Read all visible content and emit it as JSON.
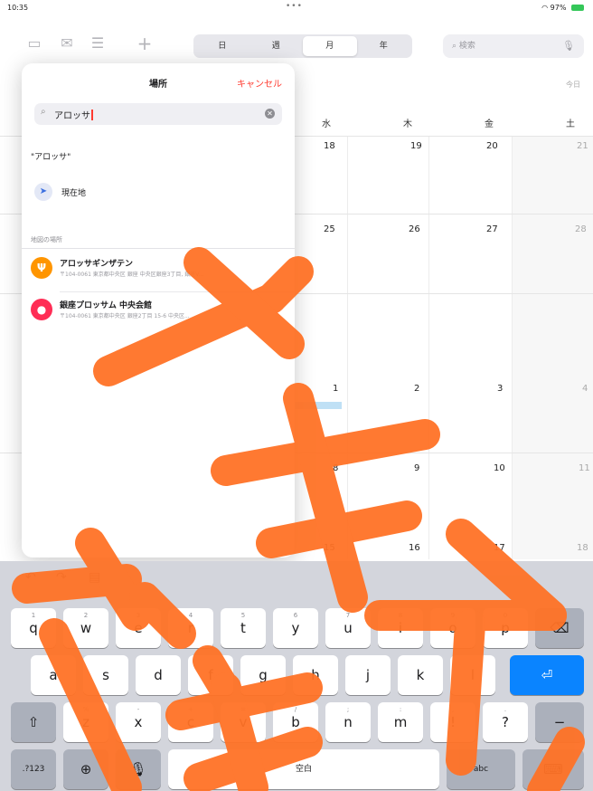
{
  "status_bar": {
    "time": "10:35",
    "dots": "•••",
    "battery_text": "97%"
  },
  "toolbar": {
    "segments": [
      "日",
      "週",
      "月",
      "年"
    ],
    "active_segment": "月",
    "search_placeholder": "検索"
  },
  "calendar": {
    "today_label": "今日",
    "weekdays": [
      "水",
      "木",
      "金",
      "土"
    ],
    "rows": [
      [
        "18",
        "19",
        "20",
        "21"
      ],
      [
        "25",
        "26",
        "27",
        "28"
      ],
      [
        "1",
        "2",
        "3",
        "4"
      ],
      [
        "8",
        "9",
        "10",
        "11"
      ],
      [
        "15",
        "16",
        "17",
        "18"
      ]
    ],
    "event_color": "#bfe0f5"
  },
  "popover": {
    "title": "場所",
    "cancel_label": "キャンセル",
    "search_query": "アロッサ",
    "literal_result": "\"アロッサ\"",
    "current_location_label": "現在地",
    "section_header": "地図の場所",
    "places": [
      {
        "name": "アロッサギンザテン",
        "address": "〒104-0061 東京都中央区 銀座 中央区銀座3丁目, 銀座V...",
        "icon": "fork-knife-icon",
        "color": "#ff9500"
      },
      {
        "name": "銀座プロッサム 中央会館",
        "address": "〒104-0061 東京都中央区 銀座2丁目 15-6 中央区...",
        "icon": "pin-icon",
        "color": "#ff2d55"
      }
    ],
    "accent_color": "#ff3b30"
  },
  "keyboard": {
    "row1": [
      "q",
      "w",
      "e",
      "r",
      "t",
      "y",
      "u",
      "i",
      "o",
      "p"
    ],
    "row1_sub": [
      "1",
      "2",
      "3",
      "4",
      "5",
      "6",
      "7",
      "8",
      "9",
      "0"
    ],
    "row2": [
      "a",
      "s",
      "d",
      "f",
      "g",
      "h",
      "j",
      "k",
      "l"
    ],
    "row3": [
      "z",
      "x",
      "c",
      "v",
      "b",
      "n",
      "m",
      "!",
      "?"
    ],
    "row3_sub": [
      "%",
      "-",
      "+",
      "=",
      "/",
      ";",
      ":",
      ",",
      "."
    ],
    "numbers_label": ".?123",
    "space_label": "空白",
    "abc_label": "abc",
    "return_color": "#0a84ff"
  }
}
